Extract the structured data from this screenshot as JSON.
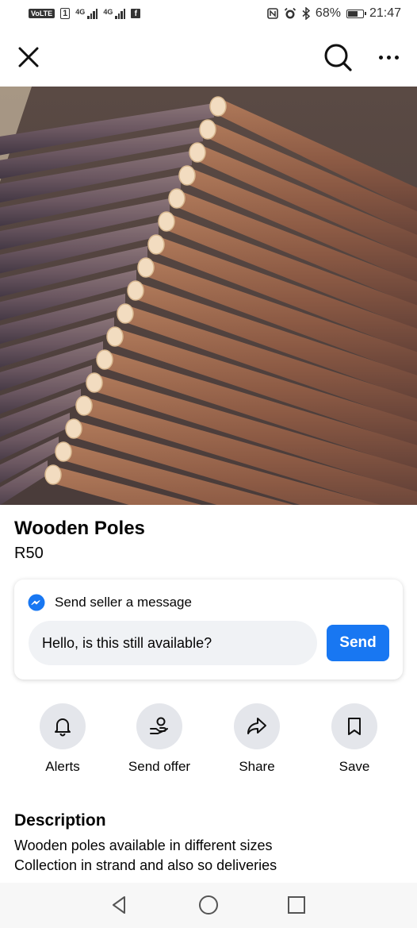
{
  "status_bar": {
    "volte": "VoLTE",
    "sim1": "1",
    "net1": "4G",
    "net2": "4G",
    "notification_badge": "f",
    "battery_percent": "68%",
    "battery_level": 0.68,
    "time": "21:47"
  },
  "header": {
    "close_icon": "close-icon",
    "search_icon": "search-icon",
    "more_icon": "more-icon"
  },
  "gallery": {
    "photo_description": "stacked-wooden-poles",
    "page_count": 3,
    "active_page": 1
  },
  "listing": {
    "title": "Wooden Poles",
    "price": "R50"
  },
  "message": {
    "heading": "Send seller a message",
    "input_value": "Hello, is this still available?",
    "send_label": "Send",
    "accent_color": "#1877f2"
  },
  "actions": [
    {
      "label": "Alerts",
      "icon": "bell-icon"
    },
    {
      "label": "Send offer",
      "icon": "offer-icon"
    },
    {
      "label": "Share",
      "icon": "share-icon"
    },
    {
      "label": "Save",
      "icon": "bookmark-icon"
    }
  ],
  "description": {
    "heading": "Description",
    "line1": "Wooden poles available in different sizes",
    "line2": "Collection in strand and also so deliveries"
  },
  "nav": {
    "back_icon": "back-triangle-icon",
    "home_icon": "home-circle-icon",
    "recents_icon": "recents-square-icon"
  }
}
